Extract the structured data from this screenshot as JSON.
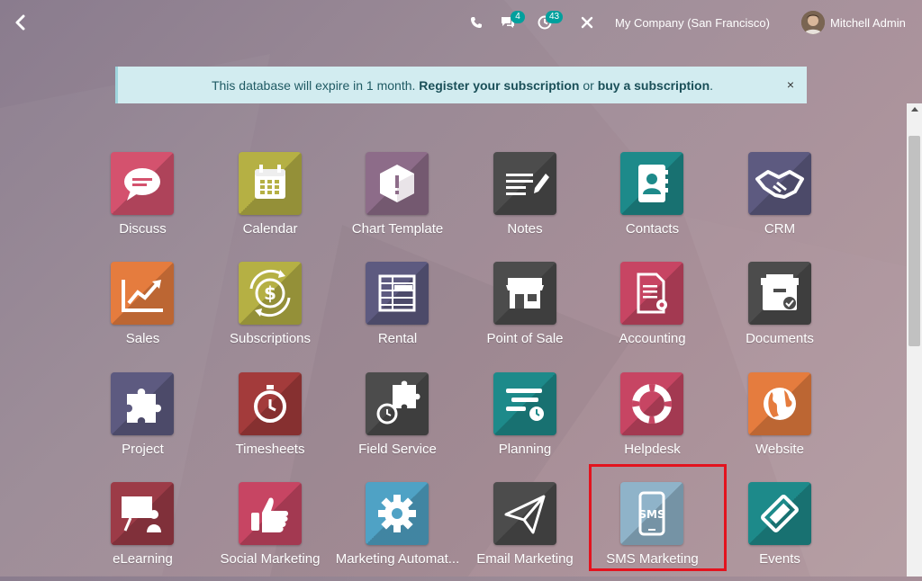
{
  "topbar": {
    "discuss_count": "4",
    "activity_count": "43",
    "company": "My Company (San Francisco)",
    "user": "Mitchell Admin"
  },
  "alert": {
    "text_before": "This database will expire in 1 month. ",
    "register_link": "Register your subscription",
    "middle": " or ",
    "buy_link": "buy a subscription",
    "end": ".",
    "close": "×"
  },
  "apps": [
    {
      "label": "Discuss",
      "color": "#d4526e",
      "icon": "chat-bubble-icon"
    },
    {
      "label": "Calendar",
      "color": "#b5b044",
      "icon": "calendar-icon"
    },
    {
      "label": "Chart Template",
      "color": "#8d6c89",
      "icon": "box-icon"
    },
    {
      "label": "Notes",
      "color": "#4c4c4c",
      "icon": "notes-pen-icon"
    },
    {
      "label": "Contacts",
      "color": "#1d8a8a",
      "icon": "address-book-icon"
    },
    {
      "label": "CRM",
      "color": "#5d5a80",
      "icon": "handshake-icon"
    },
    {
      "label": "Sales",
      "color": "#e57c3e",
      "icon": "trend-chart-icon"
    },
    {
      "label": "Subscriptions",
      "color": "#b5b044",
      "icon": "dollar-cycle-icon"
    },
    {
      "label": "Rental",
      "color": "#5d5a80",
      "icon": "grid-panel-icon"
    },
    {
      "label": "Point of Sale",
      "color": "#4c4c4c",
      "icon": "shop-icon"
    },
    {
      "label": "Accounting",
      "color": "#c74563",
      "icon": "invoice-gear-icon"
    },
    {
      "label": "Documents",
      "color": "#4c4c4c",
      "icon": "archive-box-icon"
    },
    {
      "label": "Project",
      "color": "#5d5a80",
      "icon": "puzzle-icon"
    },
    {
      "label": "Timesheets",
      "color": "#a33b3b",
      "icon": "stopwatch-icon"
    },
    {
      "label": "Field Service",
      "color": "#4c4c4c",
      "icon": "puzzle-clock-icon"
    },
    {
      "label": "Planning",
      "color": "#1d8a8a",
      "icon": "planning-bars-icon"
    },
    {
      "label": "Helpdesk",
      "color": "#c74563",
      "icon": "lifebuoy-icon"
    },
    {
      "label": "Website",
      "color": "#e57c3e",
      "icon": "globe-icon"
    },
    {
      "label": "eLearning",
      "color": "#9c3b47",
      "icon": "presentation-icon"
    },
    {
      "label": "Social Marketing",
      "color": "#c74563",
      "icon": "thumbs-up-icon"
    },
    {
      "label": "Marketing Automat...",
      "color": "#4fa2c5",
      "icon": "gear-icon"
    },
    {
      "label": "Email Marketing",
      "color": "#4c4c4c",
      "icon": "paper-plane-icon"
    },
    {
      "label": "SMS Marketing",
      "color": "#8fb3c9",
      "icon": "sms-phone-icon"
    },
    {
      "label": "Events",
      "color": "#1d8a8a",
      "icon": "ticket-icon"
    }
  ]
}
